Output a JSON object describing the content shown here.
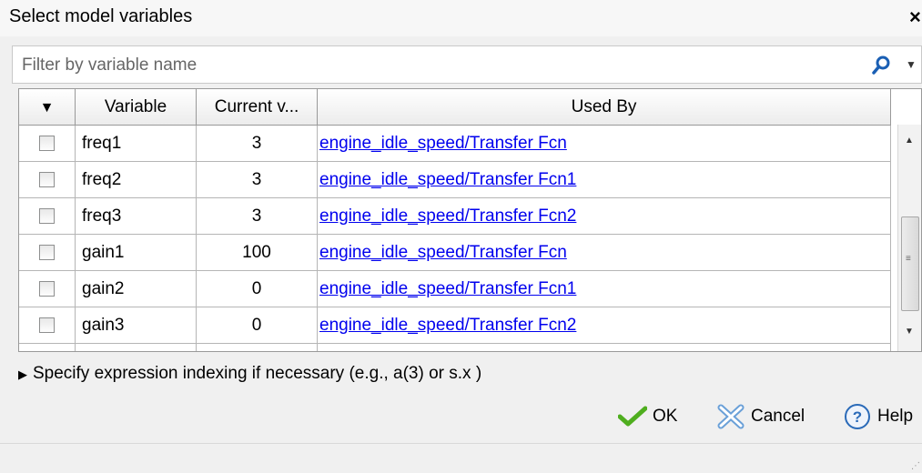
{
  "window": {
    "title": "Select model variables",
    "close_glyph": "×"
  },
  "filter": {
    "placeholder": "Filter by variable name",
    "value": ""
  },
  "table": {
    "headers": {
      "select": "▼",
      "variable": "Variable",
      "current_value": "Current v...",
      "used_by": "Used By"
    },
    "rows": [
      {
        "variable": "freq1",
        "value": "3",
        "used_by": "engine_idle_speed/Transfer Fcn"
      },
      {
        "variable": "freq2",
        "value": "3",
        "used_by": "engine_idle_speed/Transfer Fcn1"
      },
      {
        "variable": "freq3",
        "value": "3",
        "used_by": "engine_idle_speed/Transfer Fcn2"
      },
      {
        "variable": "gain1",
        "value": "100",
        "used_by": "engine_idle_speed/Transfer Fcn"
      },
      {
        "variable": "gain2",
        "value": "0",
        "used_by": "engine_idle_speed/Transfer Fcn1"
      },
      {
        "variable": "gain3",
        "value": "0",
        "used_by": "engine_idle_speed/Transfer Fcn2"
      }
    ]
  },
  "expander": {
    "label": "Specify expression indexing if necessary (e.g., a(3) or s.x )"
  },
  "buttons": {
    "ok": "OK",
    "cancel": "Cancel",
    "help": "Help"
  },
  "colors": {
    "link": "#0000ee",
    "ok_check": "#4fae1f",
    "help_blue": "#2a6ab8"
  }
}
